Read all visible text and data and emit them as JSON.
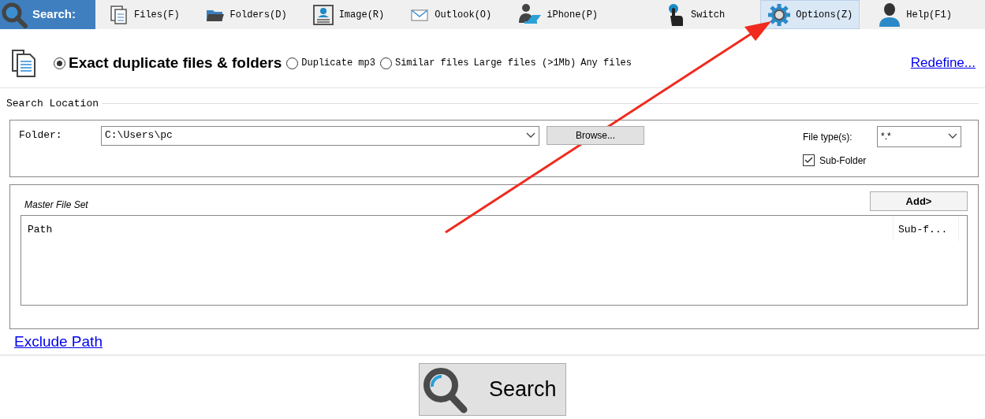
{
  "toolbar": [
    {
      "label": "Search:",
      "kind": "search",
      "selected": true,
      "hovered": false
    },
    {
      "label": "Files(F)",
      "kind": "files",
      "selected": false,
      "hovered": false
    },
    {
      "label": "Folders(D)",
      "kind": "folders",
      "selected": false,
      "hovered": false
    },
    {
      "label": "Image(R)",
      "kind": "image",
      "selected": false,
      "hovered": false
    },
    {
      "label": "Outlook(O)",
      "kind": "mail",
      "selected": false,
      "hovered": false
    },
    {
      "label": "iPhone(P)",
      "kind": "person-laptop",
      "selected": false,
      "hovered": false
    },
    {
      "label": "Switch",
      "kind": "switch",
      "selected": false,
      "hovered": false
    },
    {
      "label": "Options(Z)",
      "kind": "gear",
      "selected": false,
      "hovered": true
    },
    {
      "label": "Help(F1)",
      "kind": "person",
      "selected": false,
      "hovered": false
    }
  ],
  "modes": [
    {
      "label": "Exact duplicate files & folders",
      "kind": "radio",
      "selected": true
    },
    {
      "label": "Duplicate mp3",
      "kind": "radio",
      "selected": false
    },
    {
      "label": "Similar files",
      "kind": "radio",
      "selected": false
    },
    {
      "label": "Large files (>1Mb)",
      "kind": "text",
      "selected": false
    },
    {
      "label": "Any files",
      "kind": "text",
      "selected": false
    }
  ],
  "redefine_link": "Redefine...",
  "search_location": {
    "title": "Search Location",
    "folder_label": "Folder:",
    "folder_value": "C:\\Users\\pc",
    "browse_button": "Browse...",
    "file_types_label": "File type(s):",
    "file_types_value": "*.*",
    "sub_folder": {
      "label": "Sub-Folder",
      "checked": true
    }
  },
  "master_file_set": {
    "title": "Master File Set",
    "add_button": "Add>",
    "columns": [
      "Path",
      "Sub-f..."
    ]
  },
  "exclude_path_link": "Exclude Path",
  "search_button": "Search"
}
